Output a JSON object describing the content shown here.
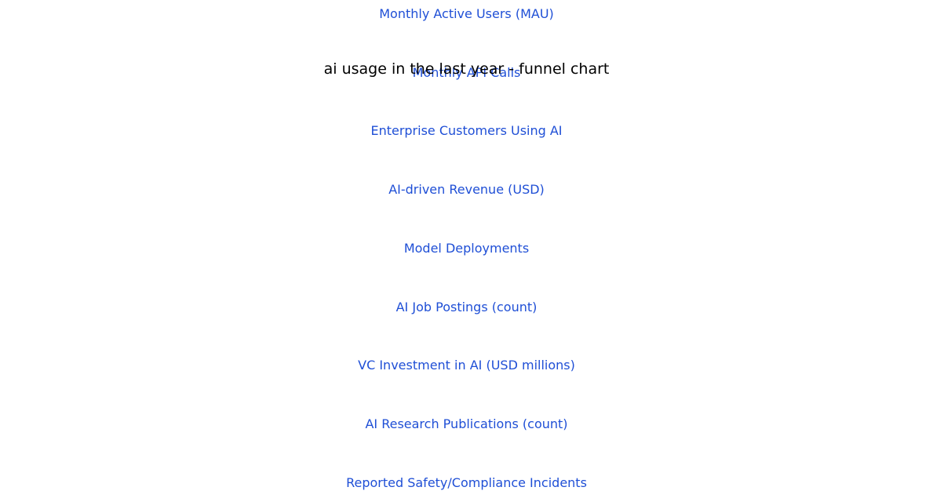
{
  "chart_data": {
    "type": "funnel",
    "title": "ai usage in the last year - funnel chart",
    "label_color": "#1f4fd6",
    "title_color": "#000000",
    "stages": [
      "Monthly Active Users (MAU)",
      "Monthly API Calls",
      "Enterprise Customers Using AI",
      "AI-driven Revenue (USD)",
      "Model Deployments",
      "AI Job Postings (count)",
      "VC Investment in AI (USD millions)",
      "AI Research Publications (count)",
      "Reported Safety/Compliance Incidents"
    ]
  }
}
